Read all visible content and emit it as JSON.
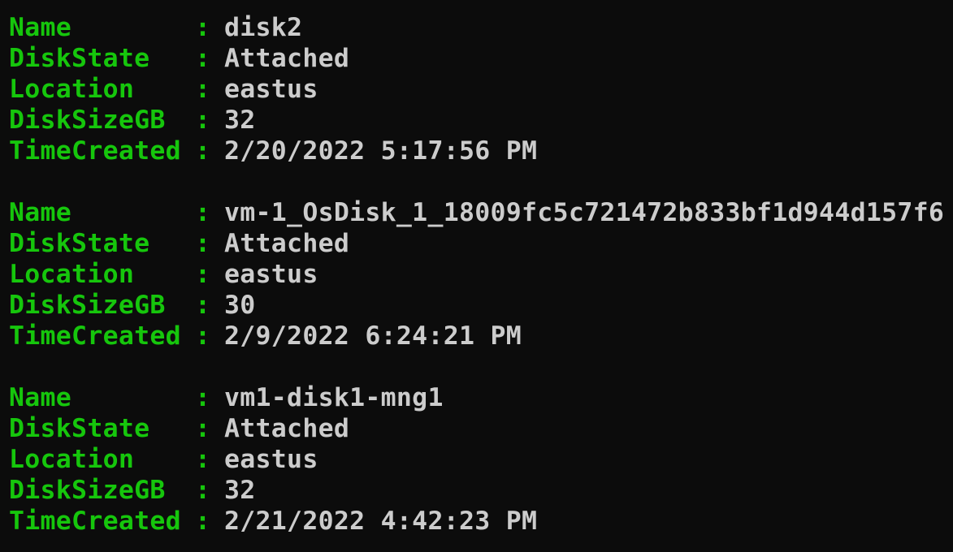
{
  "terminal": {
    "key_color": "#16c60c",
    "value_color": "#cccccc",
    "background": "#0c0c0c",
    "separator": ":",
    "records": [
      {
        "lines": [
          {
            "key": "Name",
            "value": "disk2"
          },
          {
            "key": "DiskState",
            "value": "Attached"
          },
          {
            "key": "Location",
            "value": "eastus"
          },
          {
            "key": "DiskSizeGB",
            "value": "32"
          },
          {
            "key": "TimeCreated",
            "value": "2/20/2022 5:17:56 PM"
          }
        ]
      },
      {
        "lines": [
          {
            "key": "Name",
            "value": "vm-1_OsDisk_1_18009fc5c721472b833bf1d944d157f6"
          },
          {
            "key": "DiskState",
            "value": "Attached"
          },
          {
            "key": "Location",
            "value": "eastus"
          },
          {
            "key": "DiskSizeGB",
            "value": "30"
          },
          {
            "key": "TimeCreated",
            "value": "2/9/2022 6:24:21 PM"
          }
        ]
      },
      {
        "lines": [
          {
            "key": "Name",
            "value": "vm1-disk1-mng1"
          },
          {
            "key": "DiskState",
            "value": "Attached"
          },
          {
            "key": "Location",
            "value": "eastus"
          },
          {
            "key": "DiskSizeGB",
            "value": "32"
          },
          {
            "key": "TimeCreated",
            "value": "2/21/2022 4:42:23 PM"
          }
        ]
      }
    ]
  }
}
